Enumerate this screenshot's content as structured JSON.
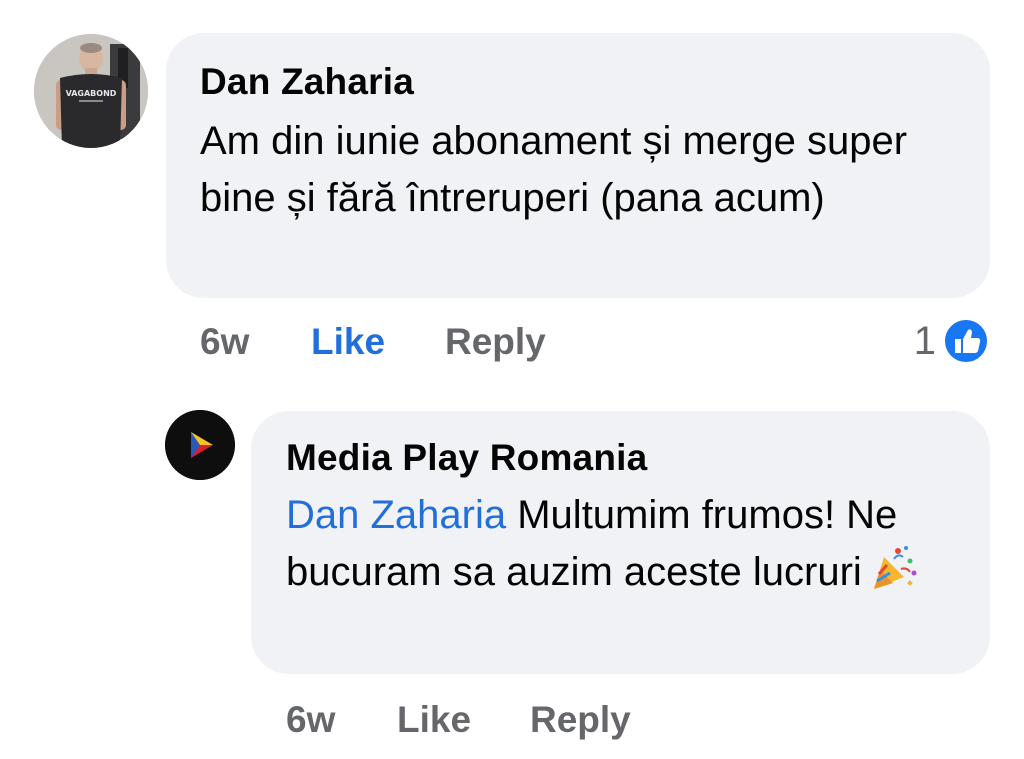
{
  "comments": [
    {
      "author": "Dan Zaharia",
      "avatar_shirt_text": "VAGABOND",
      "text": "Am din iunie abonament și merge super bine și fără întreruperi (pana acum)",
      "time": "6w",
      "like_label": "Like",
      "reply_label": "Reply",
      "like_active": true,
      "reaction_count": "1",
      "reaction_icon": "thumbs-up-icon"
    }
  ],
  "reply": {
    "author": "Media Play Romania",
    "mention": "Dan Zaharia",
    "text": " Multumim frumos! Ne bucuram sa auzim aceste lucruri",
    "emoji_icon": "party-popper-icon",
    "time": "6w",
    "like_label": "Like",
    "reply_label": "Reply"
  },
  "colors": {
    "bubble_bg": "#f0f2f5",
    "link_blue": "#216fdb",
    "meta_gray": "#65676b",
    "text": "#050505",
    "reaction_blue": "#1877f2"
  }
}
